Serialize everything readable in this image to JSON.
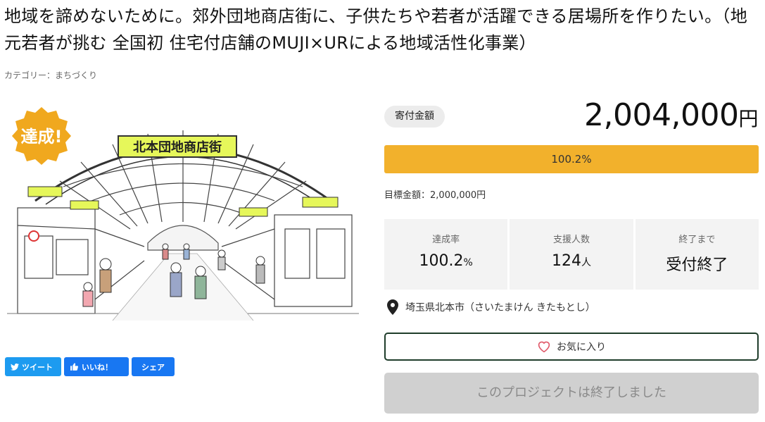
{
  "title": "地域を諦めないために。郊外団地商店街に、子供たちや若者が活躍できる居場所を作りたい。（地元若者が挑む 全国初 住宅付店舗のMUJI×URによる地域活性化事業）",
  "category": {
    "label": "カテゴリー：",
    "value": "まちづくり"
  },
  "hero": {
    "badge": "達成!",
    "sign": "北本団地商店街"
  },
  "share": {
    "tweet": "ツイート",
    "like": "いいね！",
    "share": "シェア"
  },
  "funding": {
    "label": "寄付金額",
    "amount": "2,004,000",
    "currency": "円",
    "progress_text": "100.2%",
    "progress_fraction": 1.0,
    "goal_label": "目標金額：",
    "goal_value": "2,000,000円"
  },
  "stats": [
    {
      "label": "達成率",
      "value": "100.2",
      "unit": "%"
    },
    {
      "label": "支援人数",
      "value": "124",
      "unit": "人"
    },
    {
      "label": "終了まで",
      "value": "受付終了",
      "unit": ""
    }
  ],
  "location": "埼玉県北本市（さいたまけん きたもとし）",
  "favorite": "お気に入り",
  "ended": "このプロジェクトは終了しました",
  "colors": {
    "progress": "#f2b12c",
    "badge": "#f0a81e",
    "twitter": "#1d9bf0",
    "facebook": "#1877f2",
    "favorite_border": "#1f3d2b",
    "heart": "#e05a6a"
  }
}
